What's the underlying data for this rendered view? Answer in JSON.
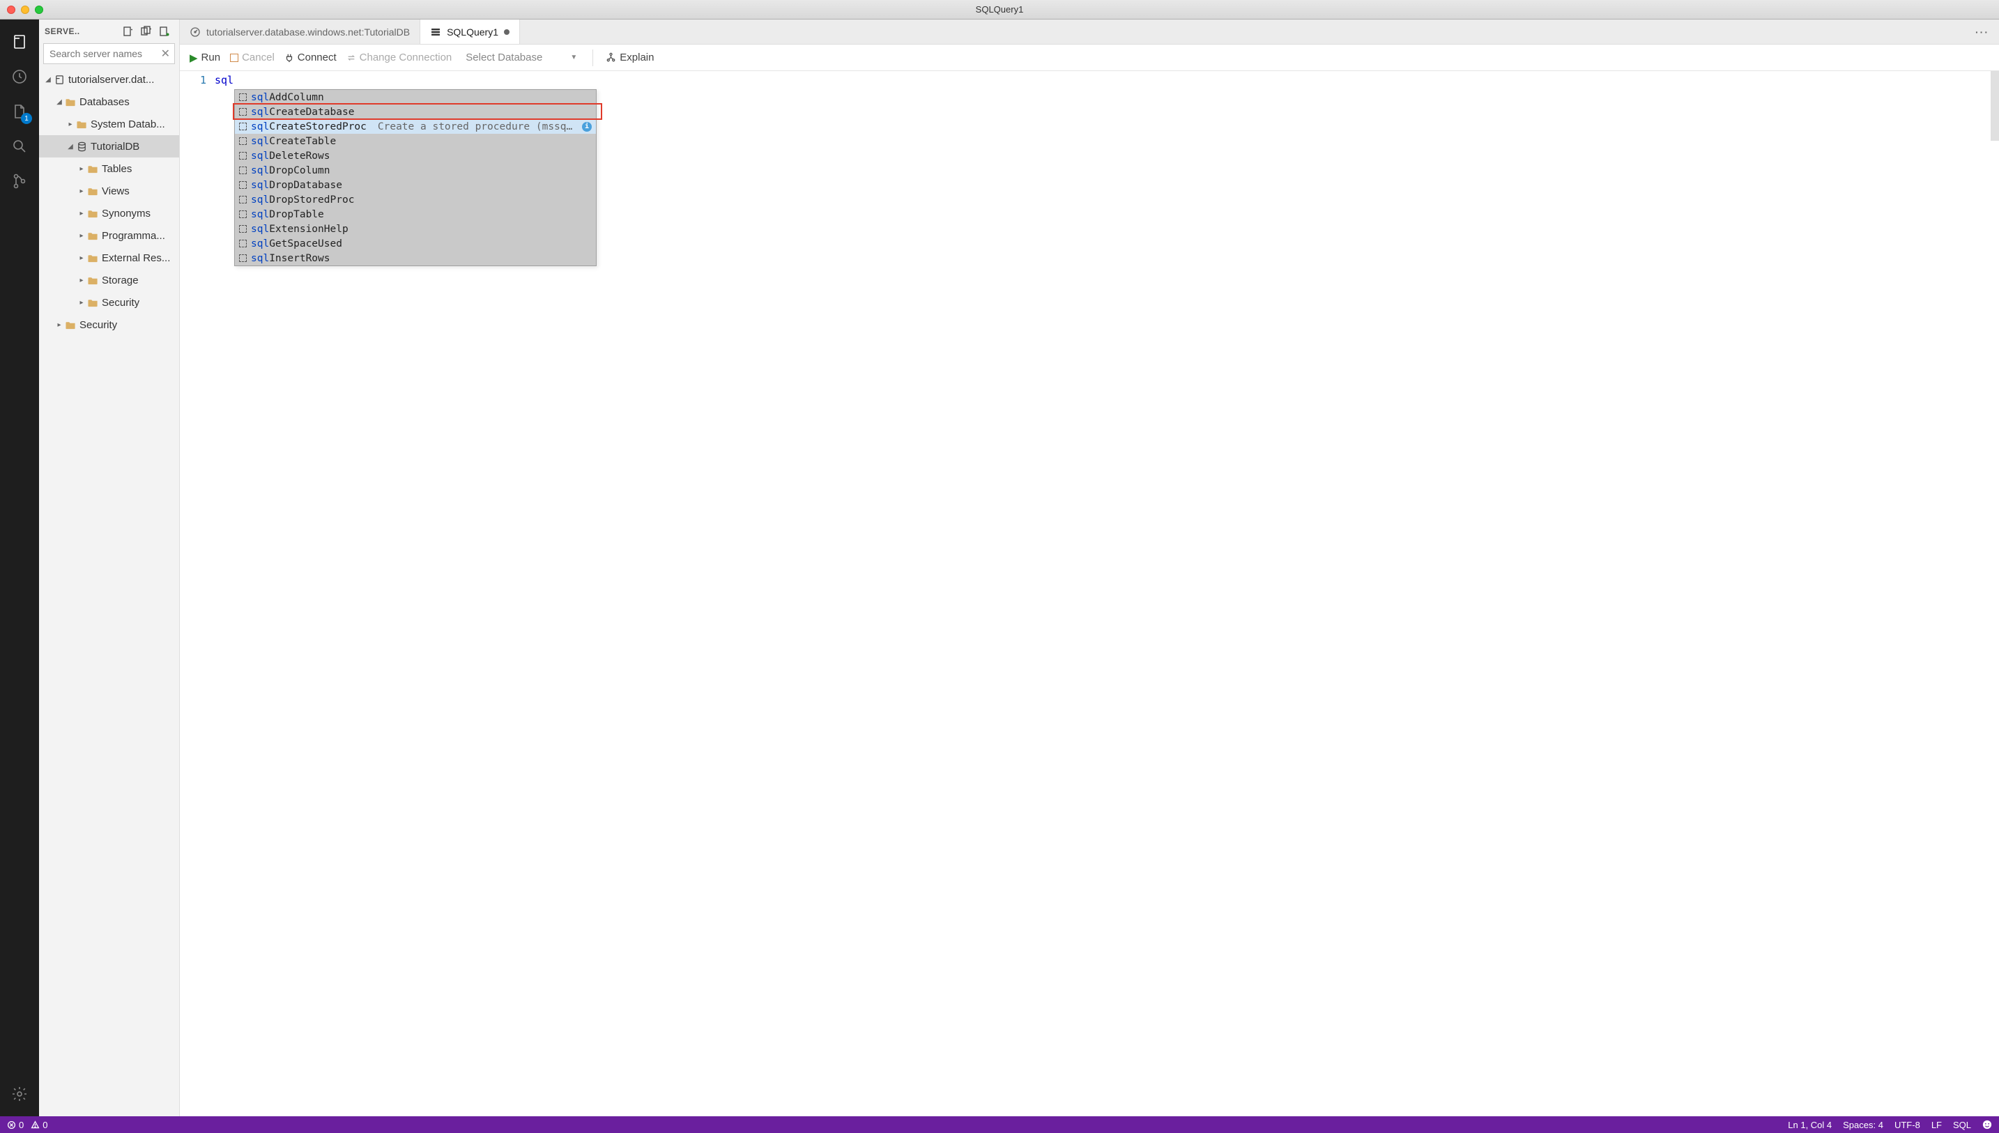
{
  "window": {
    "title": "SQLQuery1"
  },
  "activity": {
    "file_badge": "1"
  },
  "sidebar": {
    "title": "SERVE..",
    "search_placeholder": "Search server names",
    "tree": [
      {
        "level": 0,
        "expanded": true,
        "icon": "server",
        "label": "tutorialserver.dat..."
      },
      {
        "level": 1,
        "expanded": true,
        "icon": "folder",
        "label": "Databases"
      },
      {
        "level": 2,
        "expanded": false,
        "icon": "folder",
        "label": "System Datab..."
      },
      {
        "level": 2,
        "expanded": true,
        "icon": "db",
        "label": "TutorialDB",
        "selected": true
      },
      {
        "level": 3,
        "expanded": false,
        "icon": "folder",
        "label": "Tables"
      },
      {
        "level": 3,
        "expanded": false,
        "icon": "folder",
        "label": "Views"
      },
      {
        "level": 3,
        "expanded": false,
        "icon": "folder",
        "label": "Synonyms"
      },
      {
        "level": 3,
        "expanded": false,
        "icon": "folder",
        "label": "Programma..."
      },
      {
        "level": 3,
        "expanded": false,
        "icon": "folder",
        "label": "External Res..."
      },
      {
        "level": 3,
        "expanded": false,
        "icon": "folder",
        "label": "Storage"
      },
      {
        "level": 3,
        "expanded": false,
        "icon": "folder",
        "label": "Security"
      },
      {
        "level": 1,
        "expanded": false,
        "icon": "folder",
        "label": "Security"
      }
    ]
  },
  "tabs": {
    "items": [
      {
        "icon": "dashboard",
        "label": "tutorialserver.database.windows.net:TutorialDB",
        "active": false
      },
      {
        "icon": "stack",
        "label": "SQLQuery1",
        "active": true,
        "dirty": true
      }
    ]
  },
  "actions": {
    "run": "Run",
    "cancel": "Cancel",
    "connect": "Connect",
    "change": "Change Connection",
    "select_db": "Select Database",
    "explain": "Explain"
  },
  "editor": {
    "line_number": "1",
    "typed": "sql",
    "suggestions": [
      {
        "prefix": "sql",
        "rest": "AddColumn"
      },
      {
        "prefix": "sql",
        "rest": "CreateDatabase"
      },
      {
        "prefix": "sql",
        "rest": "CreateStoredProc",
        "desc": "Create a stored procedure (mssq…",
        "selected": true,
        "info": true
      },
      {
        "prefix": "sql",
        "rest": "CreateTable"
      },
      {
        "prefix": "sql",
        "rest": "DeleteRows"
      },
      {
        "prefix": "sql",
        "rest": "DropColumn"
      },
      {
        "prefix": "sql",
        "rest": "DropDatabase"
      },
      {
        "prefix": "sql",
        "rest": "DropStoredProc"
      },
      {
        "prefix": "sql",
        "rest": "DropTable"
      },
      {
        "prefix": "sql",
        "rest": "ExtensionHelp"
      },
      {
        "prefix": "sql",
        "rest": "GetSpaceUsed"
      },
      {
        "prefix": "sql",
        "rest": "InsertRows"
      }
    ]
  },
  "status": {
    "errors": "0",
    "warnings": "0",
    "ln_col": "Ln 1, Col 4",
    "spaces": "Spaces: 4",
    "encoding": "UTF-8",
    "eol": "LF",
    "lang": "SQL"
  }
}
